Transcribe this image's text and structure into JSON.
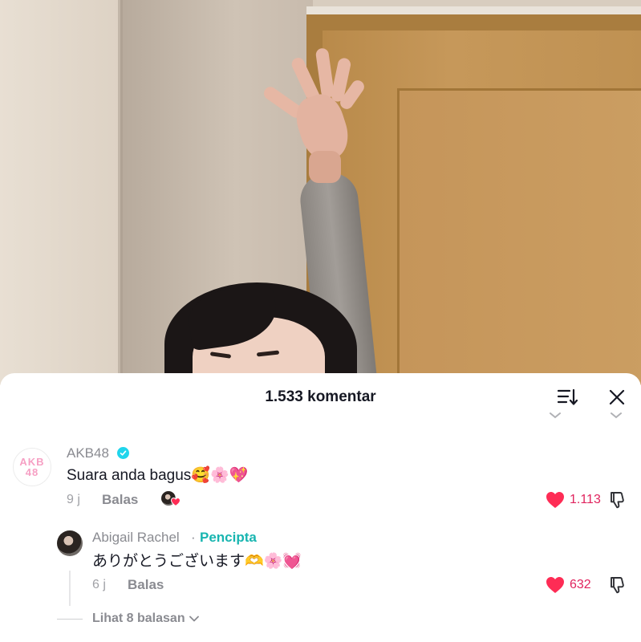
{
  "sheet": {
    "title": "1.533 komentar",
    "icons": {
      "sort": "sort-icon",
      "close": "close-icon"
    }
  },
  "comments": [
    {
      "username": "AKB48",
      "verified": true,
      "avatar_text": "AKB 48",
      "text": "Suara anda bagus",
      "emojis": "🥰🌸💖",
      "time": "9 j",
      "reply_label": "Balas",
      "likes": "1.113",
      "liked": true,
      "replies": [
        {
          "username": "Abigail Rachel",
          "separator": "·",
          "tag": "Pencipta",
          "text": "ありがとうございます",
          "emojis": "🫶🌸💓",
          "time": "6 j",
          "reply_label": "Balas",
          "likes": "632",
          "liked": true
        }
      ],
      "more_replies_label": "Lihat 8 balasan"
    }
  ],
  "colors": {
    "like": "#fe2c55",
    "creator": "#18b5b0",
    "verified": "#20d5ec"
  }
}
